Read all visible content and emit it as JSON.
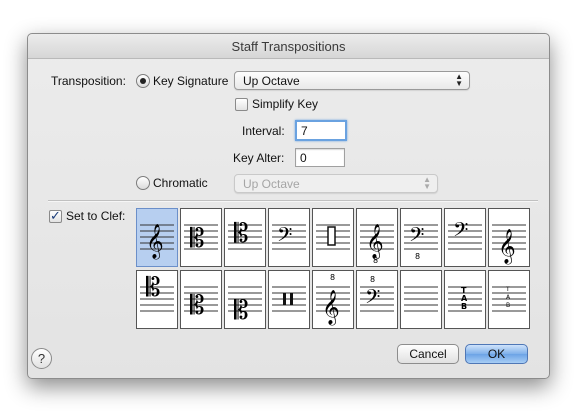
{
  "window": {
    "title": "Staff Transpositions"
  },
  "transposition": {
    "label": "Transposition:",
    "key_signature": {
      "label": "Key Signature",
      "selected": true,
      "mode": "Up Octave"
    },
    "simplify_key": {
      "label": "Simplify Key",
      "checked": false
    },
    "interval": {
      "label": "Interval:",
      "value": "7"
    },
    "key_alter": {
      "label": "Key Alter:",
      "value": "0"
    },
    "chromatic": {
      "label": "Chromatic",
      "selected": false,
      "mode": "Up Octave"
    }
  },
  "set_to_clef": {
    "label": "Set to Clef:",
    "checked": true,
    "selected_index": 0,
    "clefs": [
      "treble-clef",
      "alto-clef",
      "tenor-clef",
      "bass-clef",
      "percussion-clef",
      "treble-8vb-clef",
      "bass-8vb-clef",
      "baritone-f-clef",
      "french-violin-clef",
      "soprano-clef",
      "mezzo-soprano-clef",
      "baritone-c-clef",
      "percussion-2-clef",
      "treble-8va-clef",
      "bass-8va-clef",
      "blank-clef",
      "tab-clef",
      "tab-small-clef"
    ]
  },
  "buttons": {
    "help": "?",
    "cancel": "Cancel",
    "ok": "OK"
  },
  "colors": {
    "selection": "#b7cff0",
    "default_button": "#7fb0ea",
    "focus_ring": "#6aa2e0"
  }
}
